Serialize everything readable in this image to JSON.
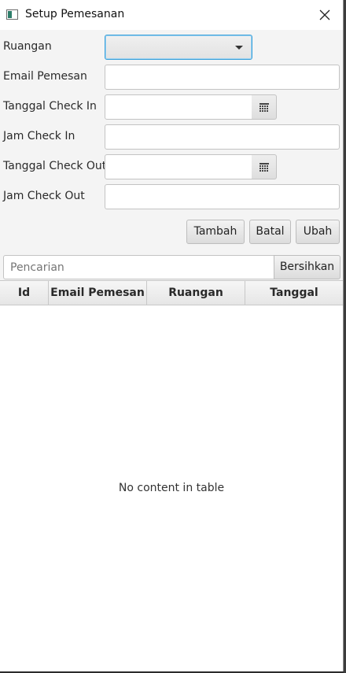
{
  "window": {
    "title": "Setup Pemesanan"
  },
  "form": {
    "ruangan_label": "Ruangan",
    "ruangan_value": "",
    "email_label": "Email Pemesan",
    "email_value": "",
    "tgl_in_label": "Tanggal Check In",
    "tgl_in_value": "",
    "jam_in_label": "Jam Check In",
    "jam_in_value": "",
    "tgl_out_label": "Tanggal Check Out",
    "tgl_out_value": "",
    "jam_out_label": "Jam Check Out",
    "jam_out_value": ""
  },
  "actions": {
    "tambah": "Tambah",
    "batal": "Batal",
    "ubah": "Ubah"
  },
  "search": {
    "placeholder": "Pencarian",
    "value": "",
    "clear_label": "Bersihkan"
  },
  "table": {
    "columns": [
      "Id",
      "Email Pemesan",
      "Ruangan",
      "Tanggal"
    ],
    "rows": [],
    "empty_text": "No content in table"
  },
  "icons": {
    "app": "app-window-icon",
    "close": "close-icon",
    "combo": "chevron-down-icon",
    "calendar": "calendar-icon"
  },
  "colors": {
    "focus_accent": "#39a0d9",
    "window_bg": "#f4f4f4"
  }
}
